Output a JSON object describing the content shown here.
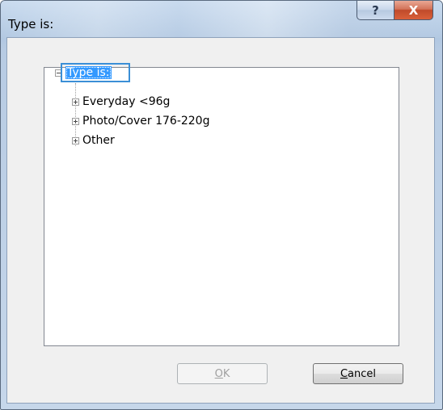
{
  "window": {
    "title": "Type is:"
  },
  "titlebar": {
    "help_glyph": "?",
    "close_glyph": "X"
  },
  "tree": {
    "root": {
      "label": "Type is:",
      "expanded": true
    },
    "items": [
      {
        "label": "Everyday <96g",
        "expanded": false
      },
      {
        "label": "Photo/Cover 176-220g",
        "expanded": false
      },
      {
        "label": "Other",
        "expanded": false
      }
    ]
  },
  "buttons": {
    "ok": {
      "mnemonic": "O",
      "rest": "K",
      "enabled": false
    },
    "cancel": {
      "mnemonic": "C",
      "rest": "ancel",
      "enabled": true
    }
  },
  "colors": {
    "selection": "#3399ff",
    "focus_border": "#3b8fd6",
    "close_button": "#c04a2a"
  }
}
